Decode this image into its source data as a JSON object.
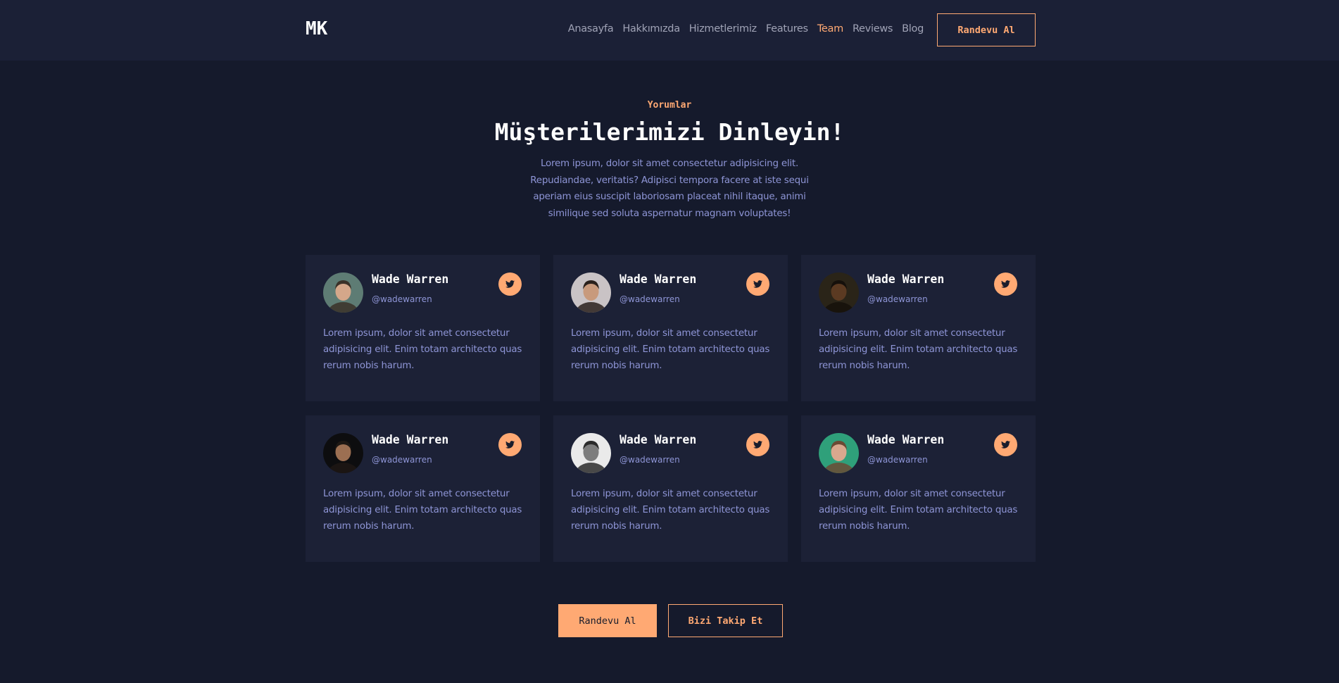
{
  "brand": {
    "logo": "MK"
  },
  "nav": {
    "links": [
      "Anasayfa",
      "Hakkımızda",
      "Hizmetlerimiz",
      "Features",
      "Team",
      "Reviews",
      "Blog"
    ],
    "active": "Team",
    "cta_label": "Randevu Al"
  },
  "section": {
    "eyebrow": "Yorumlar",
    "title": "Müşterilerimizi Dinleyin!",
    "description": "Lorem ipsum, dolor sit amet consectetur adipisicing elit. Repudiandae, veritatis? Adipisci tempora facere at iste sequi aperiam eius suscipit laboriosam placeat nihil itaque, animi similique sed soluta aspernatur magnam voluptates!"
  },
  "testimonials": [
    {
      "name": "Wade Warren",
      "handle": "@wadewarren",
      "text": "Lorem ipsum, dolor sit amet consectetur adipisicing elit. Enim totam architecto quas rerum nobis harum.",
      "avatar_bg": "#5e7c74",
      "avatar_face": "#d4a78a",
      "avatar_hair": "#3a3128"
    },
    {
      "name": "Wade Warren",
      "handle": "@wadewarren",
      "text": "Lorem ipsum, dolor sit amet consectetur adipisicing elit. Enim totam architecto quas rerum nobis harum.",
      "avatar_bg": "#c9c3c5",
      "avatar_face": "#c89a7c",
      "avatar_hair": "#2a211c"
    },
    {
      "name": "Wade Warren",
      "handle": "@wadewarren",
      "text": "Lorem ipsum, dolor sit amet consectetur adipisicing elit. Enim totam architecto quas rerum nobis harum.",
      "avatar_bg": "#2a2418",
      "avatar_face": "#5b3a22",
      "avatar_hair": "#15100b"
    },
    {
      "name": "Wade Warren",
      "handle": "@wadewarren",
      "text": "Lorem ipsum, dolor sit amet consectetur adipisicing elit. Enim totam architecto quas rerum nobis harum.",
      "avatar_bg": "#0d0d0f",
      "avatar_face": "#9c6f52",
      "avatar_hair": "#1e1814"
    },
    {
      "name": "Wade Warren",
      "handle": "@wadewarren",
      "text": "Lorem ipsum, dolor sit amet consectetur adipisicing elit. Enim totam architecto quas rerum nobis harum.",
      "avatar_bg": "#eaeaea",
      "avatar_face": "#7d7d7d",
      "avatar_hair": "#2b2b2b"
    },
    {
      "name": "Wade Warren",
      "handle": "@wadewarren",
      "text": "Lorem ipsum, dolor sit amet consectetur adipisicing elit. Enim totam architecto quas rerum nobis harum.",
      "avatar_bg": "#2fa07a",
      "avatar_face": "#d9a88e",
      "avatar_hair": "#6b4a34"
    }
  ],
  "social_icon": "twitter-icon",
  "actions": {
    "primary_label": "Randevu Al",
    "secondary_label": "Bizi Takip Et"
  },
  "colors": {
    "accent": "#ffa973",
    "background": "#151a2c",
    "card": "#1c2136",
    "muted_text": "#8e95d6"
  }
}
